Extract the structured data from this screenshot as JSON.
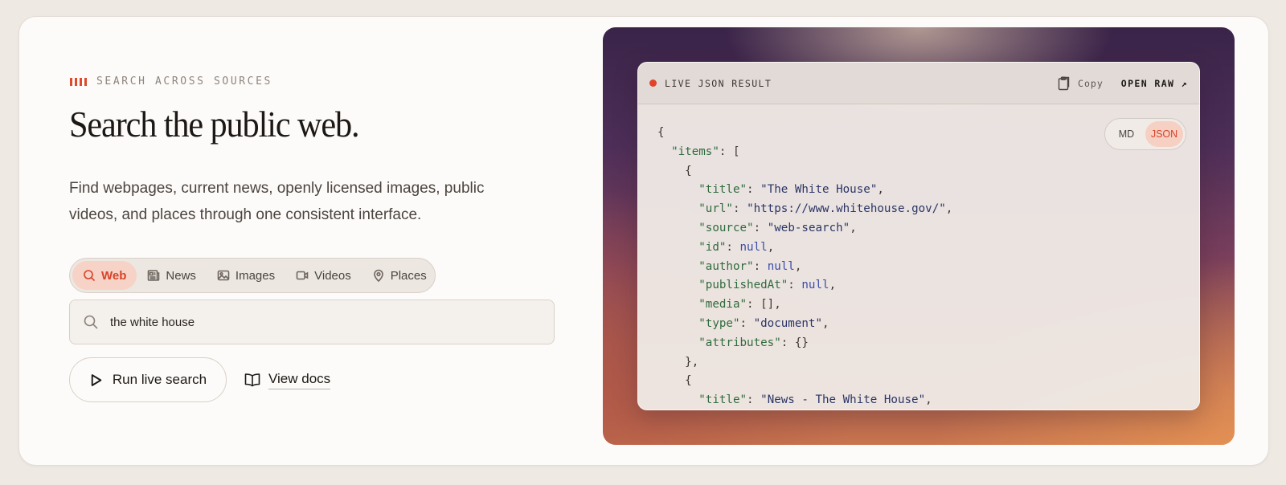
{
  "hero": {
    "eyebrow": "SEARCH ACROSS SOURCES",
    "title": "Search the public web.",
    "description": "Find webpages, current news, openly licensed images, public videos, and places through one consistent interface."
  },
  "tabs": [
    {
      "label": "Web",
      "icon": "search-icon",
      "active": true
    },
    {
      "label": "News",
      "icon": "newspaper-icon",
      "active": false
    },
    {
      "label": "Images",
      "icon": "image-icon",
      "active": false
    },
    {
      "label": "Videos",
      "icon": "video-icon",
      "active": false
    },
    {
      "label": "Places",
      "icon": "map-pin-icon",
      "active": false
    }
  ],
  "search": {
    "value": "the white house",
    "icon": "search-icon"
  },
  "actions": {
    "run_label": "Run live search",
    "docs_label": "View docs"
  },
  "result_panel": {
    "title": "LIVE JSON RESULT",
    "copy_label": "Copy",
    "open_raw_label": "OPEN RAW ↗",
    "formats": [
      {
        "label": "MD",
        "active": false
      },
      {
        "label": "JSON",
        "active": true
      }
    ],
    "items": [
      {
        "title": "The White House",
        "url": "https://www.whitehouse.gov/",
        "source": "web-search",
        "id": "null",
        "author": "null",
        "publishedAt": "null",
        "media": "[]",
        "type": "document",
        "attributes": "{}"
      },
      {
        "title": "News - The White House"
      }
    ]
  },
  "colors": {
    "accent": "#dd4a2e",
    "active_tab_bg": "#f6d3c6"
  }
}
